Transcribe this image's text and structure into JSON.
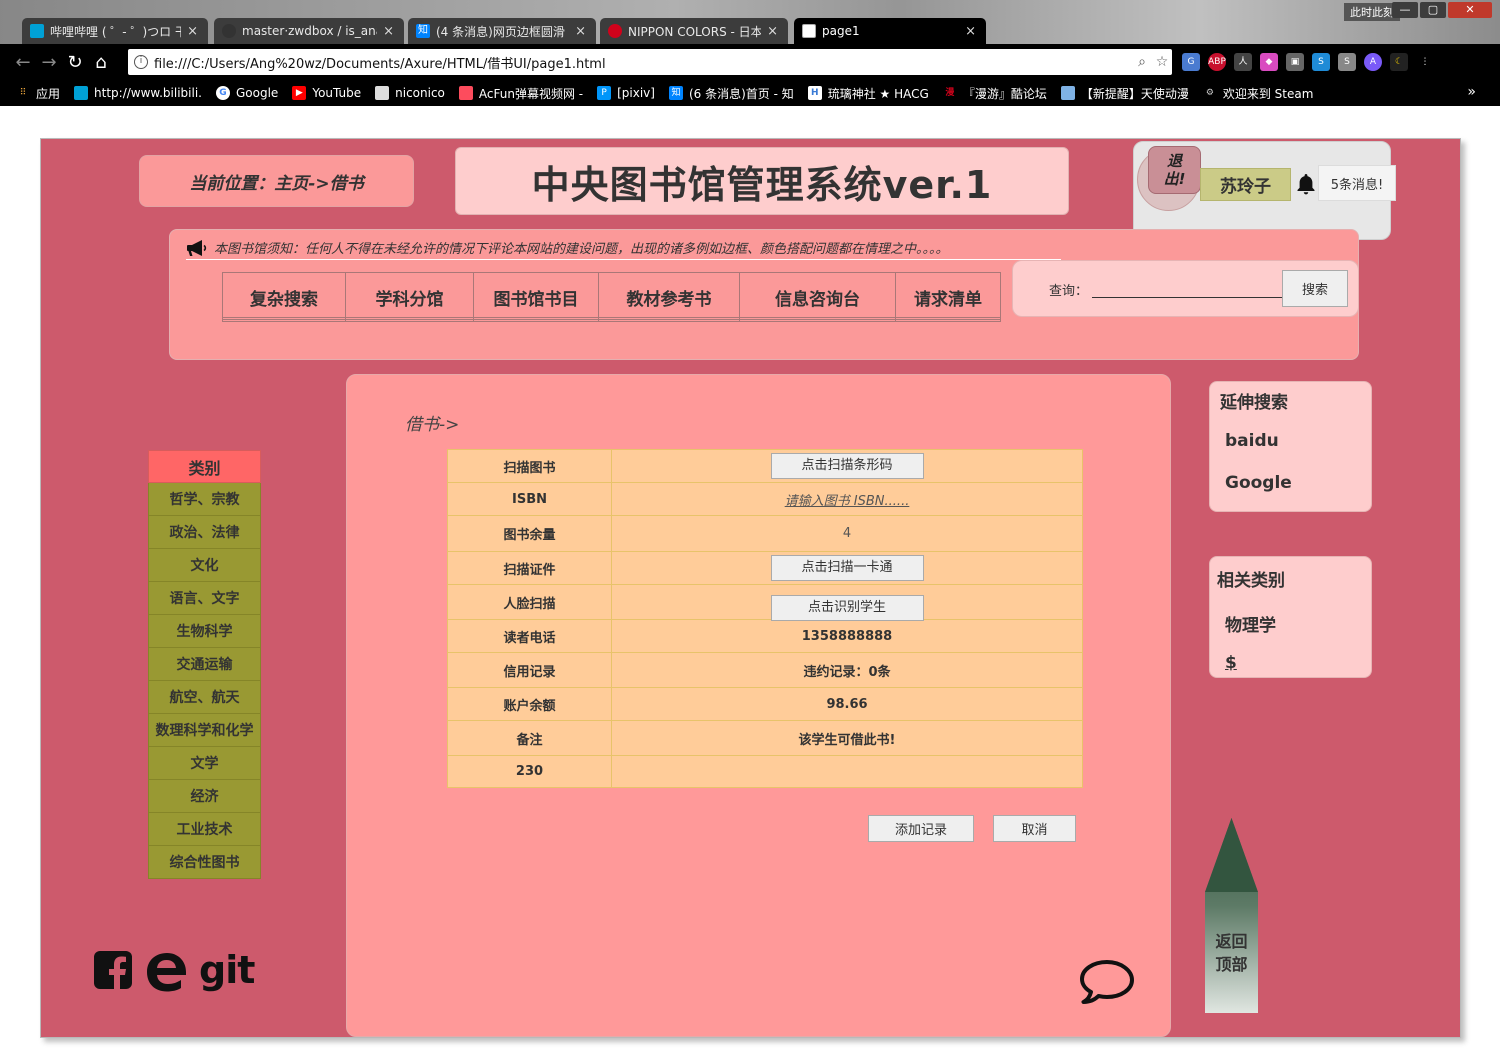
{
  "browser": {
    "tabs": [
      {
        "title": "哔哩哔哩 ( ゜- ゜)つロ 干杯",
        "favicon_color": "#00a1d6",
        "active": false
      },
      {
        "title": "master·zwdbox / is_ana",
        "favicon_color": "#333333",
        "active": false
      },
      {
        "title": "(4 条消息)网页边框圆滑",
        "favicon_color": "#0084ff",
        "favicon_text": "知",
        "active": false
      },
      {
        "title": "NIPPON COLORS - 日本",
        "favicon_color": "#d0021b",
        "active": false
      },
      {
        "title": "page1",
        "favicon_color": "#ffffff",
        "active": true
      }
    ],
    "corner_label": "此时此刻",
    "url": "file:///C:/Users/Ang%20wz/Documents/Axure/HTML/借书UI/page1.html",
    "bookmarks": [
      {
        "label": "应用",
        "icon": "apps-grid-icon",
        "color": "#e8a33d"
      },
      {
        "label": "http://www.bilibili.",
        "icon": "bilibili-icon",
        "color": "#00a1d6"
      },
      {
        "label": "Google",
        "icon": "google-icon",
        "color": "#ffffff"
      },
      {
        "label": "YouTube",
        "icon": "youtube-icon",
        "color": "#ff0000"
      },
      {
        "label": "niconico",
        "icon": "niconico-icon",
        "color": "#dddddd"
      },
      {
        "label": "AcFun弹幕视频网 -",
        "icon": "acfun-icon",
        "color": "#fd4c5d"
      },
      {
        "label": "[pixiv]",
        "icon": "pixiv-icon",
        "color": "#0096fa"
      },
      {
        "label": "(6 条消息)首页 - 知",
        "icon": "zhihu-icon",
        "color": "#0084ff"
      },
      {
        "label": "琉璃神社 ★ HACG",
        "icon": "hacg-icon",
        "color": "#3a7bd5"
      },
      {
        "label": "『漫游』酷论坛",
        "icon": "manyou-icon",
        "color": "#d0021b"
      },
      {
        "label": "【新提醒】天使动漫",
        "icon": "tsdm-icon",
        "color": "#7fb2e5"
      },
      {
        "label": "欢迎来到 Steam",
        "icon": "steam-icon",
        "color": "#cccccc"
      }
    ]
  },
  "header": {
    "location": "当前位置：主页->借书",
    "title": "中央图书馆管理系统ver.1",
    "logout": "退出!",
    "username": "苏玲子",
    "messages": "5条消息!"
  },
  "notice": "本图书馆须知：任何人不得在未经允许的情况下评论本网站的建设问题，出现的诸多例如边框、颜色搭配问题都在情理之中。。。。",
  "nav_tabs": [
    "复杂搜索",
    "学科分馆",
    "图书馆书目",
    "教材参考书",
    "信息咨询台",
    "请求清单"
  ],
  "search": {
    "label": "查询：",
    "value": "",
    "button": "搜索"
  },
  "categories": {
    "header": "类别",
    "items": [
      "哲学、宗教",
      "政治、法律",
      "文化",
      "语言、文字",
      "生物科学",
      "交通运输",
      "航空、航天",
      "数理科学和化学",
      "文学",
      "经济",
      "工业技术",
      "综合性图书"
    ]
  },
  "main": {
    "breadcrumb": "借书->",
    "rows": [
      {
        "label": "扫描图书",
        "button": "点击扫描条形码"
      },
      {
        "label": "ISBN",
        "placeholder": "请输入图书 ISBN......"
      },
      {
        "label": "图书余量",
        "value": "4"
      },
      {
        "label": "扫描证件",
        "button": "点击扫描一卡通"
      },
      {
        "label": "人脸扫描",
        "button": "点击识别学生"
      },
      {
        "label": "读者电话",
        "value": "1358888888"
      },
      {
        "label": "信用记录",
        "value": "违约记录：0条"
      },
      {
        "label": "账户余额",
        "value": "98.66"
      },
      {
        "label": "备注",
        "value": "该学生可借此书!"
      },
      {
        "label": "230",
        "value": ""
      }
    ],
    "add_button": "添加记录",
    "cancel_button": "取消"
  },
  "extended_search": {
    "title": "延伸搜索",
    "links": [
      "baidu",
      "Google"
    ]
  },
  "related": {
    "title": "相关类别",
    "links": [
      "物理学",
      "$"
    ]
  },
  "back_to_top": "返回顶部",
  "social": {
    "git_label": "git"
  },
  "colors": {
    "stage": "#cd5a6c",
    "pink_light": "#fecdcd",
    "pink_mid": "#ff9999",
    "olive": "#999933",
    "category_header": "#ff6666",
    "table_bg": "#ffcc99"
  }
}
